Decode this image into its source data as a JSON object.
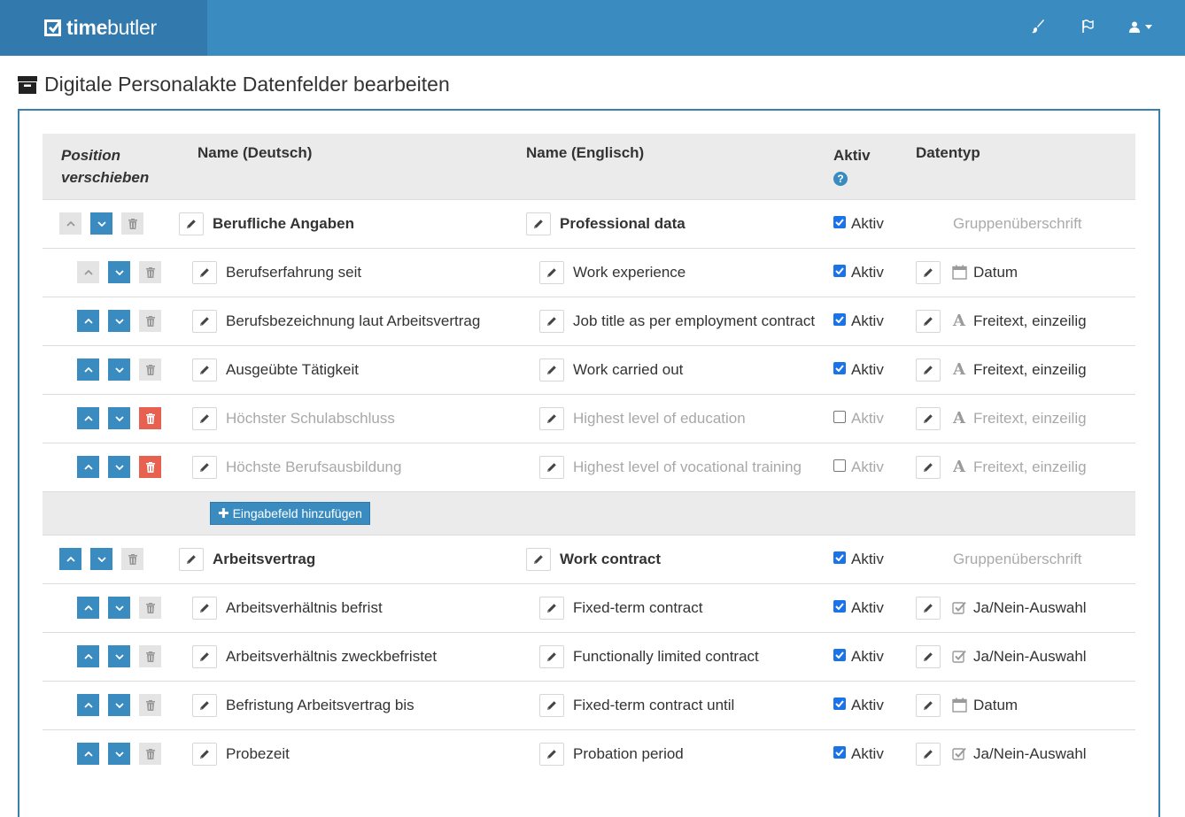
{
  "brand": {
    "name_bold": "time",
    "name_light": "butler"
  },
  "navbar": {
    "icons": [
      "brush-icon",
      "flag-icon",
      "user-icon",
      "caret-down-icon"
    ]
  },
  "page": {
    "title": "Digitale Personalakte Datenfelder bearbeiten",
    "title_icon": "archive-icon"
  },
  "table": {
    "headers": {
      "position_line1": "Position",
      "position_line2": "verschieben",
      "name_de": "Name (Deutsch)",
      "name_en": "Name (Englisch)",
      "active": "Aktiv",
      "active_help": "?",
      "type": "Datentyp"
    },
    "active_label": "Aktiv",
    "group_type_label": "Gruppenüberschrift",
    "add_field_label": "Eingabefeld hinzufügen",
    "rows": [
      {
        "kind": "group",
        "de": "Berufliche Angaben",
        "en": "Professional data",
        "active": true,
        "up_enabled": false
      },
      {
        "kind": "field",
        "de": "Berufserfahrung seit",
        "en": "Work experience",
        "active": true,
        "type": "Datum",
        "type_icon": "calendar-icon",
        "up_enabled": false,
        "delete_enabled": false
      },
      {
        "kind": "field",
        "de": "Berufsbezeichnung laut Arbeitsvertrag",
        "en": "Job title as per employment contract",
        "active": true,
        "type": "Freitext, einzeilig",
        "type_icon": "font-icon",
        "up_enabled": true,
        "delete_enabled": false
      },
      {
        "kind": "field",
        "de": "Ausgeübte Tätigkeit",
        "en": "Work carried out",
        "active": true,
        "type": "Freitext, einzeilig",
        "type_icon": "font-icon",
        "up_enabled": true,
        "delete_enabled": false
      },
      {
        "kind": "field",
        "de": "Höchster Schulabschluss",
        "en": "Highest level of education",
        "active": false,
        "type": "Freitext, einzeilig",
        "type_icon": "font-icon",
        "up_enabled": true,
        "delete_enabled": true
      },
      {
        "kind": "field",
        "de": "Höchste Berufsausbildung",
        "en": "Highest level of vocational training",
        "active": false,
        "type": "Freitext, einzeilig",
        "type_icon": "font-icon",
        "up_enabled": true,
        "delete_enabled": true
      },
      {
        "kind": "add"
      },
      {
        "kind": "group",
        "de": "Arbeitsvertrag",
        "en": "Work contract",
        "active": true,
        "up_enabled": true
      },
      {
        "kind": "field",
        "de": "Arbeitsverhältnis befrist",
        "en": "Fixed-term contract",
        "active": true,
        "type": "Ja/Nein-Auswahl",
        "type_icon": "checkbox-icon",
        "up_enabled": true,
        "delete_enabled": false
      },
      {
        "kind": "field",
        "de": "Arbeitsverhältnis zweckbefristet",
        "en": "Functionally limited contract",
        "active": true,
        "type": "Ja/Nein-Auswahl",
        "type_icon": "checkbox-icon",
        "up_enabled": true,
        "delete_enabled": false
      },
      {
        "kind": "field",
        "de": "Befristung Arbeitsvertrag bis",
        "en": "Fixed-term contract until",
        "active": true,
        "type": "Datum",
        "type_icon": "calendar-icon",
        "up_enabled": true,
        "delete_enabled": false
      },
      {
        "kind": "field",
        "de": "Probezeit",
        "en": "Probation period",
        "active": true,
        "type": "Ja/Nein-Auswahl",
        "type_icon": "checkbox-icon",
        "up_enabled": true,
        "delete_enabled": false
      }
    ]
  },
  "colors": {
    "navbar": "#3a8bc0",
    "brand_bg": "#3279ad",
    "button_blue": "#3a8bc0",
    "button_red": "#e8604f",
    "panel_border": "#3a7fb0"
  }
}
